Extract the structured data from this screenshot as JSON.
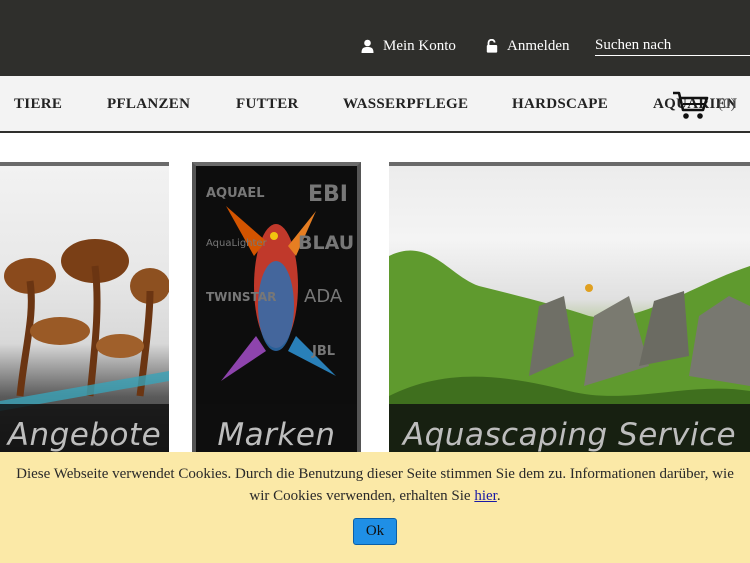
{
  "header": {
    "account_label": "Mein Konto",
    "login_label": "Anmelden",
    "search_placeholder": "Suchen nach"
  },
  "nav": {
    "items": [
      {
        "label": "TIERE"
      },
      {
        "label": "PFLANZEN"
      },
      {
        "label": "FUTTER"
      },
      {
        "label": "WASSERPFLEGE"
      },
      {
        "label": "HARDSCAPE"
      },
      {
        "label": "AQUARIEN"
      }
    ],
    "cart_count": "(0)"
  },
  "banners": [
    {
      "label": "Angebote"
    },
    {
      "label": "Marken",
      "brands": [
        "AQUAEL",
        "EBI",
        "AquaLighter",
        "BLAU",
        "TWINSTAR",
        "ADA",
        "JBL"
      ]
    },
    {
      "label": "Aquascaping Service"
    }
  ],
  "cookie": {
    "text_before": "Diese Webseite verwendet Cookies. Durch die Benutzung dieser Seite stimmen Sie dem zu. Informationen darüber, wie wir Cookies verwenden, erhalten Sie ",
    "link_label": "hier",
    "text_after": ".",
    "ok_label": "Ok"
  },
  "colors": {
    "topbar": "#2f2f2c",
    "nav_bg": "#f3f3f3",
    "cookie_bg": "#fbe9a7",
    "ok_button": "#1f8fe6"
  },
  "icons": [
    "user-icon",
    "unlock-icon",
    "cart-icon"
  ]
}
